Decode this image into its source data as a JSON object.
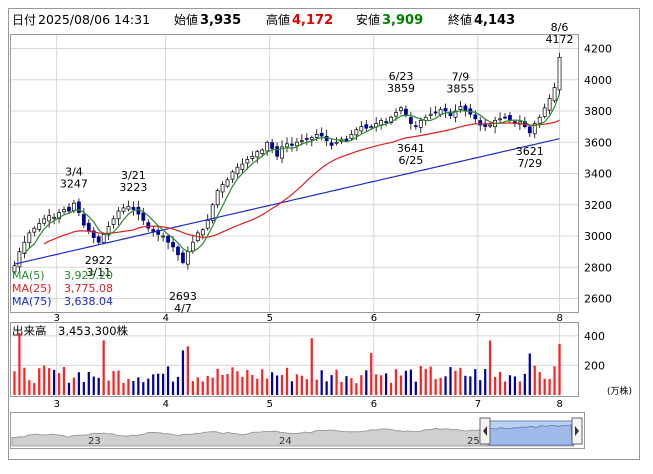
{
  "header": {
    "date_label": "日付",
    "datetime": "2025/08/06 14:31",
    "open_label": "始値",
    "open_value": "3,935",
    "high_label": "高値",
    "high_value": "4,172",
    "low_label": "安値",
    "low_value": "3,909",
    "close_label": "終値",
    "close_value": "4,143"
  },
  "colors": {
    "up": "#ff2020",
    "down": "#0000a0",
    "ma5": "#2a8a2a",
    "ma25": "#e02020",
    "ma75": "#1a2ad0",
    "high": "#e00000",
    "low": "#008000",
    "grid": "#d8d8d8"
  },
  "ma_legend": [
    {
      "label": "MA(5)",
      "value": "3,925.20",
      "color": "#2a8a2a"
    },
    {
      "label": "MA(25)",
      "value": "3,775.08",
      "color": "#e02020"
    },
    {
      "label": "MA(75)",
      "value": "3,638.04",
      "color": "#1a2ad0"
    }
  ],
  "volume": {
    "label": "出来高",
    "value": "3,453,300株",
    "unit": "(万株)"
  },
  "navigator_labels": [
    "23",
    "24",
    "25"
  ],
  "chart_data": [
    {
      "type": "candlestick",
      "title": "",
      "price_axis": {
        "ticks": [
          2600,
          2800,
          3000,
          3200,
          3400,
          3600,
          3800,
          4000,
          4200
        ],
        "range": [
          2520,
          4280
        ]
      },
      "x_ticks": [
        "3",
        "4",
        "5",
        "6",
        "7",
        "8"
      ],
      "annotations": [
        {
          "label": "3/4",
          "value": "3247",
          "date_index": 12
        },
        {
          "label": "3/21",
          "value": "3223",
          "date_index": 24
        },
        {
          "label": "2922",
          "value": "3/11",
          "date_index": 17
        },
        {
          "label": "2693",
          "value": "4/7",
          "date_index": 34
        },
        {
          "label": "6/23",
          "value": "3859",
          "date_index": 78
        },
        {
          "label": "3641",
          "value": "6/25",
          "date_index": 80
        },
        {
          "label": "7/9",
          "value": "3855",
          "date_index": 90
        },
        {
          "label": "3621",
          "value": "7/29",
          "date_index": 104
        },
        {
          "label": "8/6",
          "value": "4172",
          "date_index": 110
        }
      ],
      "series_close": [
        2810,
        2900,
        2960,
        3020,
        3050,
        3080,
        3110,
        3130,
        3120,
        3150,
        3170,
        3160,
        3210,
        3150,
        3070,
        3030,
        2990,
        2960,
        3010,
        3060,
        3110,
        3160,
        3180,
        3190,
        3170,
        3140,
        3100,
        3050,
        3030,
        3010,
        3000,
        2960,
        2930,
        2880,
        2830,
        2900,
        2960,
        3020,
        3040,
        3100,
        3200,
        3290,
        3330,
        3360,
        3410,
        3440,
        3460,
        3490,
        3510,
        3540,
        3550,
        3600,
        3560,
        3510,
        3570,
        3590,
        3580,
        3600,
        3610,
        3620,
        3630,
        3650,
        3640,
        3610,
        3580,
        3600,
        3620,
        3610,
        3650,
        3680,
        3700,
        3690,
        3700,
        3720,
        3740,
        3730,
        3760,
        3790,
        3820,
        3770,
        3720,
        3700,
        3740,
        3760,
        3780,
        3790,
        3810,
        3800,
        3770,
        3800,
        3830,
        3800,
        3780,
        3750,
        3710,
        3700,
        3710,
        3740,
        3750,
        3760,
        3740,
        3720,
        3730,
        3700,
        3660,
        3720,
        3760,
        3820,
        3880,
        3950,
        4143
      ],
      "ma_end_values": {
        "MA(5)": 3925.2,
        "MA(25)": 3775.08,
        "MA(75)": 3638.04
      },
      "volume_axis": {
        "ticks": [
          200,
          400
        ],
        "unit": "万株"
      },
      "last_volume": 345.33
    }
  ]
}
